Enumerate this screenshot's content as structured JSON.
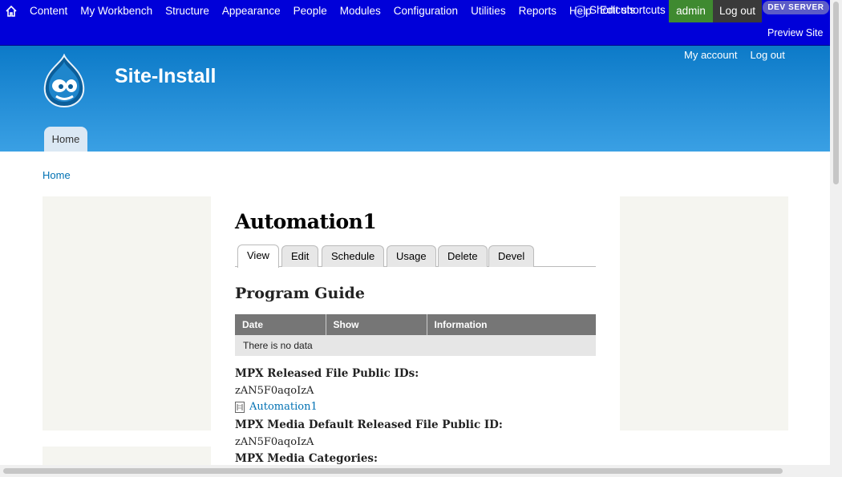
{
  "toolbar": {
    "menu": [
      "Content",
      "My Workbench",
      "Structure",
      "Appearance",
      "People",
      "Modules",
      "Configuration",
      "Utilities",
      "Reports",
      "Help"
    ],
    "shortcuts_label": "Shortcuts",
    "edit_shortcuts_label": "Edit shortcuts",
    "user": "admin",
    "logout": "Log out",
    "dev_badge": "DEV SERVER",
    "preview_site": "Preview Site",
    "colors": {
      "background": "#0000d9",
      "admin": "#3f8a30",
      "logout": "#3a3a3a"
    }
  },
  "header": {
    "site_name": "Site-Install",
    "my_account": "My account",
    "log_out": "Log out",
    "home_tab": "Home",
    "colors": {
      "gradient_top": "#0c7ac8",
      "gradient_bottom": "#3aa0e4"
    }
  },
  "breadcrumb": "Home",
  "main": {
    "page_title": "Automation1",
    "tabs": [
      "View",
      "Edit",
      "Schedule",
      "Usage",
      "Delete",
      "Devel"
    ],
    "active_tab": "View",
    "section_title": "Program Guide",
    "table": {
      "headers": [
        "Date",
        "Show",
        "Information"
      ],
      "empty_message": "There is no data"
    },
    "fields": {
      "released_ids_label": "MPX Released File Public IDs:",
      "released_ids_value": "zAN5F0aqoIzA",
      "file_link": "Automation1",
      "default_id_label": "MPX Media Default Released File Public ID:",
      "default_id_value": "zAN5F0aqoIzA",
      "categories_label": "MPX Media Categories:"
    }
  },
  "icons": [
    "home-icon",
    "shortcuts-circle-icon",
    "drupal-logo-icon",
    "document-icon"
  ]
}
